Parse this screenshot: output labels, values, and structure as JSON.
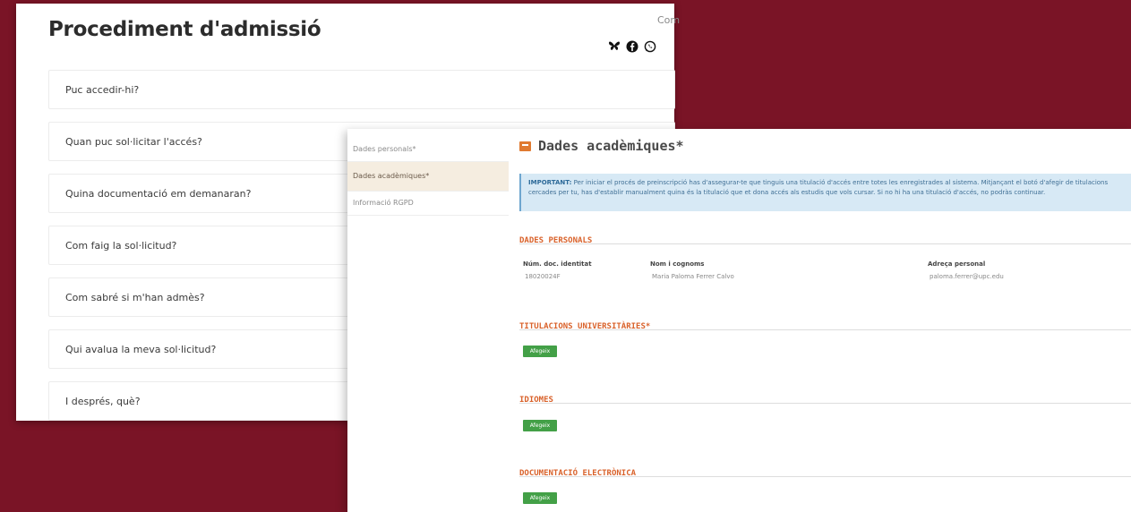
{
  "faq_page": {
    "title": "Procediment d'admissió",
    "share_label": "Com",
    "share_icons": [
      "butterfly-icon",
      "facebook-icon",
      "whatsapp-icon"
    ],
    "items": [
      "Puc accedir-hi?",
      "Quan puc sol·licitar l'accés?",
      "Quina documentació em demanaran?",
      "Com faig la sol·licitud?",
      "Com sabré si m'han admès?",
      "Qui avalua la meva sol·licitud?",
      "I després, què?"
    ]
  },
  "form": {
    "steps": [
      "Dades personals*",
      "Dades acadèmiques*",
      "Informació RGPD"
    ],
    "active_step": 1,
    "section_title": "Dades acadèmiques*",
    "notice": {
      "label": "IMPORTANT:",
      "text": "Per iniciar el procés de preinscripció has d'assegurar-te que tinguis una titulació d'accés entre totes les enregistrades al sistema. Mitjançant el botó d'afegir de titulacions cercades per tu, has d'establir manualment quina és la titulació que et dona accés als estudis que vols cursar. Si no hi ha una titulació d'accés, no podràs continuar."
    },
    "personal": {
      "heading": "DADES PERSONALS",
      "fields": [
        {
          "label": "Núm. doc. identitat",
          "value": "18020024F"
        },
        {
          "label": "Nom i cognoms",
          "value": "Maria Paloma Ferrer Calvo"
        },
        {
          "label": "Adreça personal",
          "value": "paloma.ferrer@upc.edu"
        }
      ]
    },
    "subsections": [
      {
        "heading": "TITULACIONS UNIVERSITÀRIES*",
        "button": "Afegeix"
      },
      {
        "heading": "IDIOMES",
        "button": "Afegeix"
      },
      {
        "heading": "DOCUMENTACIÓ ELECTRÒNICA",
        "button": "Afegeix"
      }
    ]
  },
  "colors": {
    "background": "#7a1426",
    "accent": "#d9622b",
    "notice": "#d7e9f5",
    "button": "#43a047"
  }
}
